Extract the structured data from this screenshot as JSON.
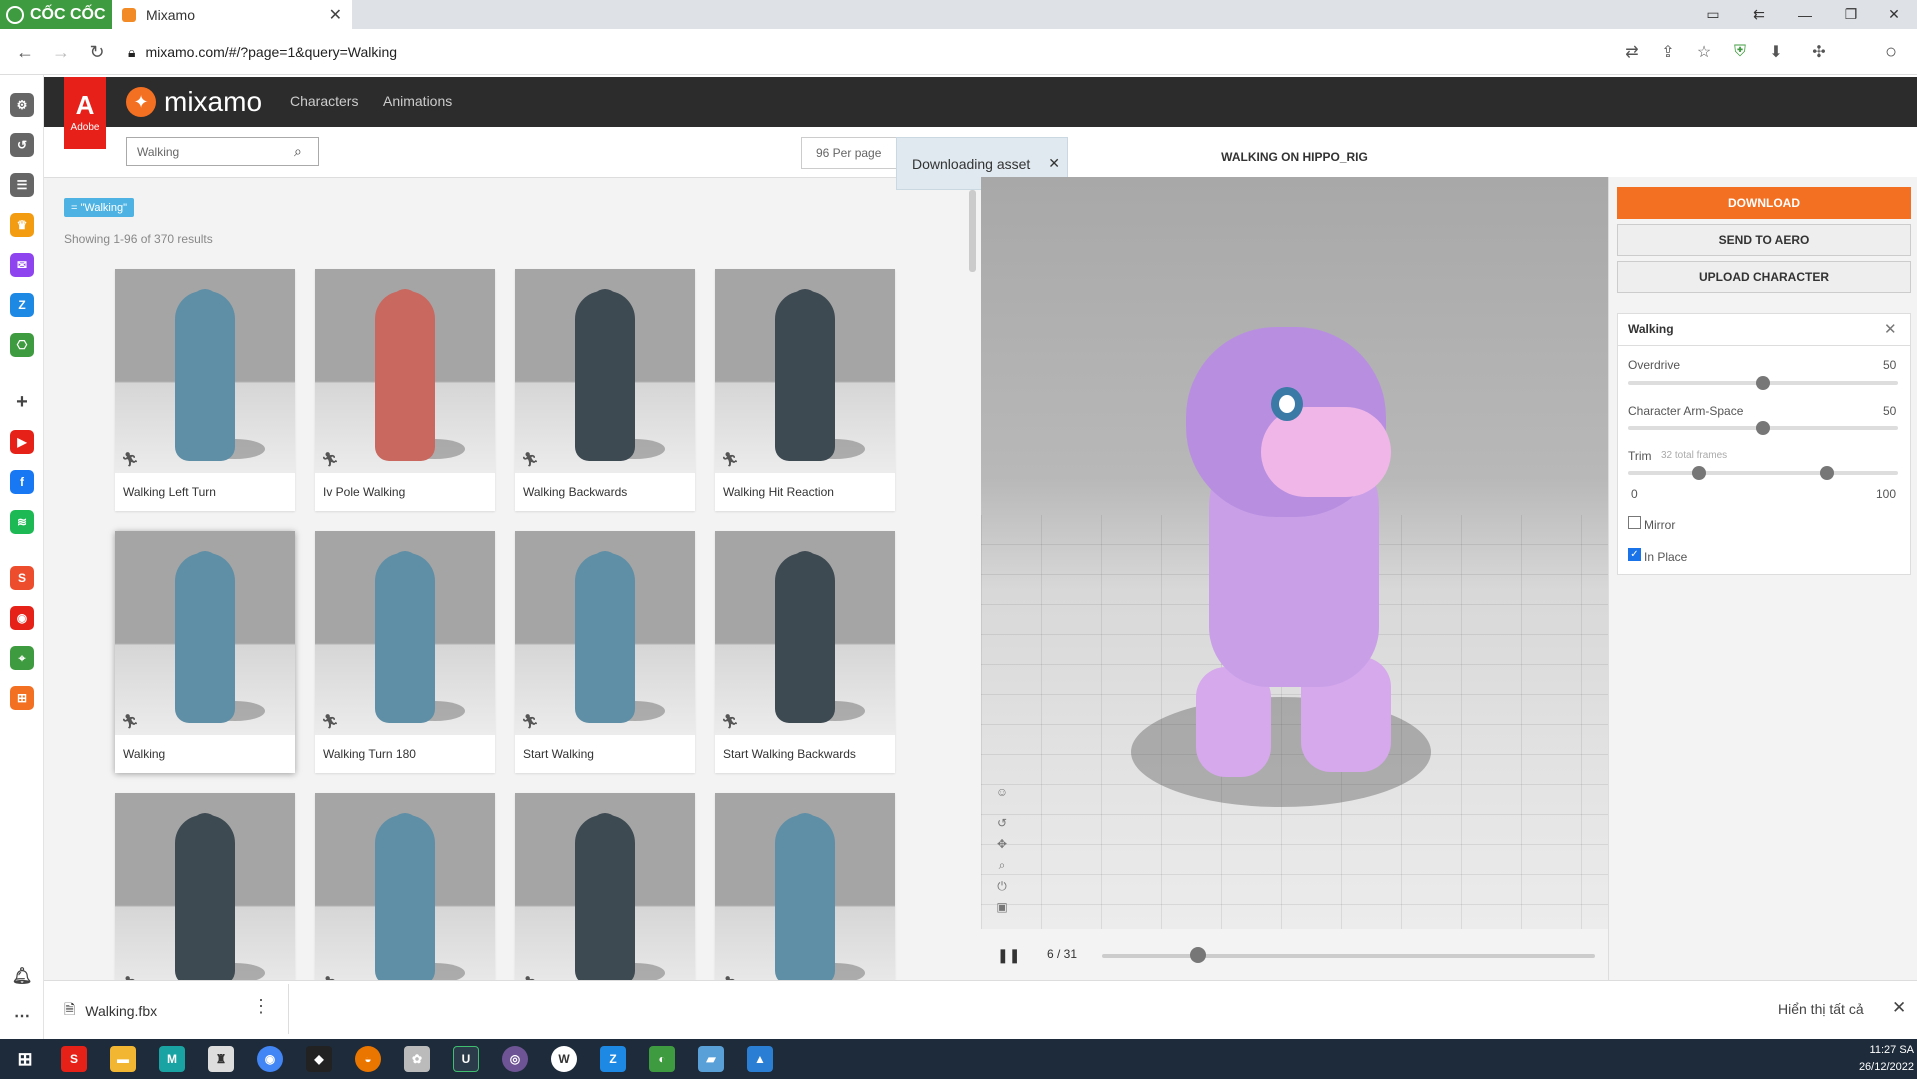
{
  "browser": {
    "brand": "CỐC CỐC",
    "tab_title": "Mixamo",
    "tab_close": "✕",
    "url": "mixamo.com/#/?page=1&query=Walking"
  },
  "mixamo": {
    "adobe_label": "Adobe",
    "logo_text": "mixamo",
    "nav": [
      "Characters",
      "Animations"
    ],
    "search_value": "Walking",
    "per_page": "96 Per page",
    "toast": "Downloading asset",
    "filter_tag": "= \"Walking\"",
    "showing": "Showing 1-96 of 370 results"
  },
  "cards": [
    {
      "label": "Walking Left Turn",
      "color": "#5f8fa6"
    },
    {
      "label": "Iv Pole Walking",
      "color": "#c9685f"
    },
    {
      "label": "Walking Backwards",
      "color": "#3e4a52"
    },
    {
      "label": "Walking Hit Reaction",
      "color": "#3e4a52"
    },
    {
      "label": "Walking",
      "color": "#5f8fa6"
    },
    {
      "label": "Walking Turn 180",
      "color": "#5f8fa6"
    },
    {
      "label": "Start Walking",
      "color": "#5f8fa6"
    },
    {
      "label": "Start Walking Backwards",
      "color": "#3e4a52"
    },
    {
      "label": "",
      "color": "#3e4a52"
    },
    {
      "label": "",
      "color": "#5f8fa6"
    },
    {
      "label": "",
      "color": "#3e4a52"
    },
    {
      "label": "",
      "color": "#5f8fa6"
    }
  ],
  "viewer": {
    "title": "WALKING ON HIPPO_RIG",
    "frame": "6 / 31",
    "frame_progress": 0.194
  },
  "actions": {
    "download": "DOWNLOAD",
    "send": "SEND TO AERO",
    "upload": "UPLOAD CHARACTER"
  },
  "settings": {
    "title": "Walking",
    "overdrive_label": "Overdrive",
    "overdrive_value": "50",
    "armspace_label": "Character Arm-Space",
    "armspace_value": "50",
    "trim_label": "Trim",
    "trim_frames": "32 total frames",
    "trim_min": "0",
    "trim_max": "100",
    "mirror_label": "Mirror",
    "mirror_checked": false,
    "inplace_label": "In Place",
    "inplace_checked": true
  },
  "downloads": {
    "file": "Walking.fbx",
    "show_all": "Hiển thị tất cả"
  },
  "clock": {
    "time": "11:27 SA",
    "date": "26/12/2022"
  },
  "colors": {
    "accent": "#f36f21",
    "adobe_red": "#e7201a",
    "tag_blue": "#4eb3e3"
  }
}
